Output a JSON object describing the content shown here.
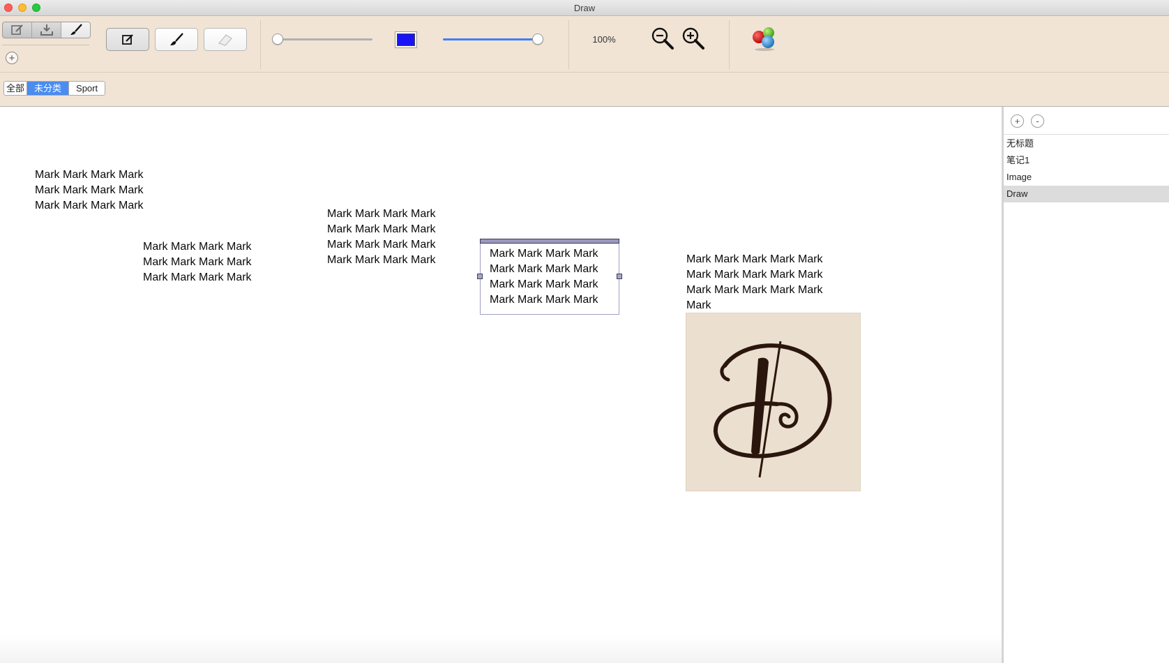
{
  "window": {
    "title": "Draw"
  },
  "toolbar": {
    "segment_icons": [
      "edit-icon",
      "download-icon",
      "brush-icon"
    ],
    "tool_icons": [
      "edit-icon",
      "brush-icon",
      "eraser-icon"
    ],
    "brush_size_level": 0.0,
    "color": "#1a14f5",
    "opacity_level": 1.0,
    "zoom_label": "100%"
  },
  "categories": {
    "items": [
      "全部",
      "未分类",
      "Sport"
    ],
    "selected": "未分类"
  },
  "canvas": {
    "text_blocks": [
      "Mark Mark Mark Mark\nMark Mark Mark Mark\nMark Mark Mark Mark",
      "Mark Mark Mark Mark\nMark Mark Mark Mark\nMark Mark Mark Mark",
      "Mark Mark Mark Mark\nMark Mark Mark Mark\nMark Mark Mark Mark\nMark Mark Mark Mark",
      "Mark Mark Mark Mark\nMark Mark Mark Mark\nMark Mark Mark Mark\nMark Mark Mark Mark",
      "Mark Mark Mark Mark Mark\nMark Mark Mark Mark Mark\nMark Mark Mark Mark Mark\nMark"
    ],
    "image_letter": "D"
  },
  "sidebar": {
    "add_label": "+",
    "remove_label": "-",
    "notes": [
      "无标题",
      "笔记1",
      "Image",
      "Draw"
    ],
    "selected_note": "Draw"
  },
  "colors": {
    "toolbar_bg": "#f1e4d5",
    "category_selected": "#4a8cf0",
    "slider_blue": "#3b82f6"
  }
}
